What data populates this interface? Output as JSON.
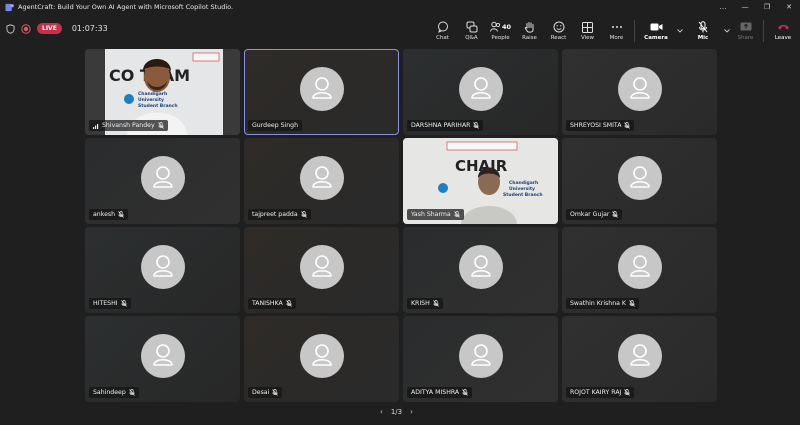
{
  "window": {
    "title": "AgentCraft: Build Your Own AI Agent with Microsoft Copilot Studio.",
    "controls": [
      "…",
      "—",
      "❐",
      "✕"
    ]
  },
  "meeting": {
    "live_label": "LIVE",
    "timer": "01:07:33"
  },
  "toolbar": {
    "chat": "Chat",
    "qa": "Q&A",
    "people": "People",
    "people_count": "40",
    "raise": "Raise",
    "react": "React",
    "view": "View",
    "more": "More",
    "camera": "Camera",
    "mic": "Mic",
    "share": "Share",
    "leave": "Leave"
  },
  "board_text": {
    "t1": "CO TEAM",
    "t2": "CHAIR",
    "uni1": "Chandigarh",
    "uni2": "University",
    "uni3": "Student Branch"
  },
  "tiles": [
    {
      "name": "Shivansh Pandey",
      "type": "video"
    },
    {
      "name": "Gurdeep Singh",
      "type": "avatar"
    },
    {
      "name": "DARSHNA PARIHAR",
      "type": "avatar"
    },
    {
      "name": "SHREYOSI SMITA",
      "type": "avatar"
    },
    {
      "name": "ankesh",
      "type": "avatar"
    },
    {
      "name": "tajpreet padda",
      "type": "avatar"
    },
    {
      "name": "Yash Sharma",
      "type": "video"
    },
    {
      "name": "Omkar Gujar",
      "type": "avatar"
    },
    {
      "name": "HITESHI",
      "type": "avatar"
    },
    {
      "name": "TANISHKA",
      "type": "avatar"
    },
    {
      "name": "KRISH",
      "type": "avatar"
    },
    {
      "name": "Swathin Krishna K",
      "type": "avatar"
    },
    {
      "name": "Sahindeep",
      "type": "avatar"
    },
    {
      "name": "Desai",
      "type": "avatar"
    },
    {
      "name": "ADITYA MISHRA",
      "type": "avatar"
    },
    {
      "name": "ROJOT KAIRY RAJ",
      "type": "avatar"
    }
  ],
  "pager": {
    "prev": "‹",
    "label": "1/3",
    "next": "›"
  },
  "colors": {
    "accent": "#7b83eb",
    "live": "#c4314b",
    "leave": "#c4314b",
    "avatar": "#c7c7c7"
  }
}
